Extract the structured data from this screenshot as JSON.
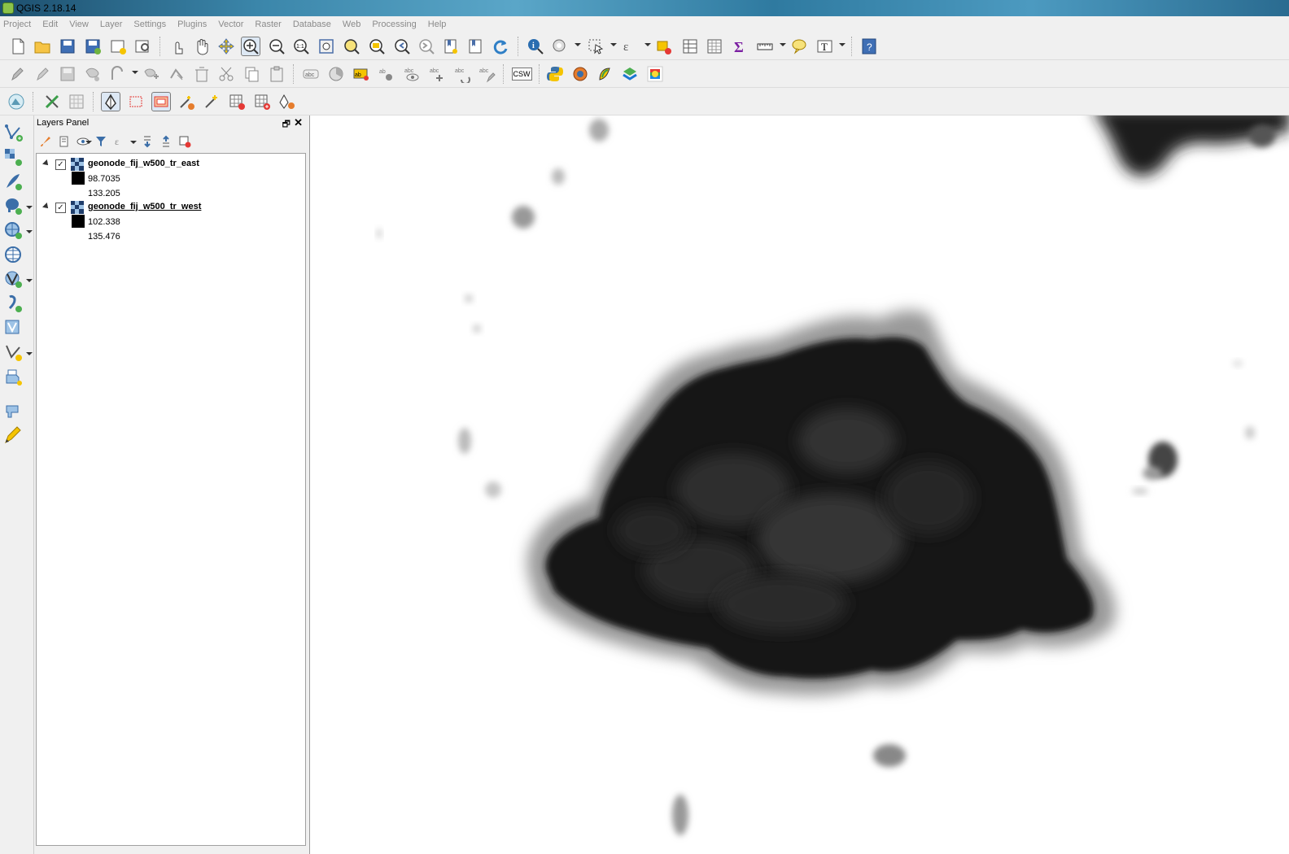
{
  "window": {
    "title": "QGIS 2.18.14"
  },
  "menu": [
    "Project",
    "Edit",
    "View",
    "Layer",
    "Settings",
    "Plugins",
    "Vector",
    "Raster",
    "Database",
    "Web",
    "Processing",
    "Help"
  ],
  "toolbar2": {
    "csw_label": "CSW"
  },
  "layers_panel": {
    "title": "Layers Panel",
    "layers": [
      {
        "name": "geonode_fij_w500_tr_east",
        "checked": true,
        "min": "98.7035",
        "max": "133.205"
      },
      {
        "name": "geonode_fij_w500_tr_west",
        "checked": true,
        "min": "102.338",
        "max": "135.476"
      }
    ]
  },
  "colors": {
    "accent": "#3b86aa",
    "raster_dark": "#111111",
    "canvas_bg": "#ffffff"
  }
}
